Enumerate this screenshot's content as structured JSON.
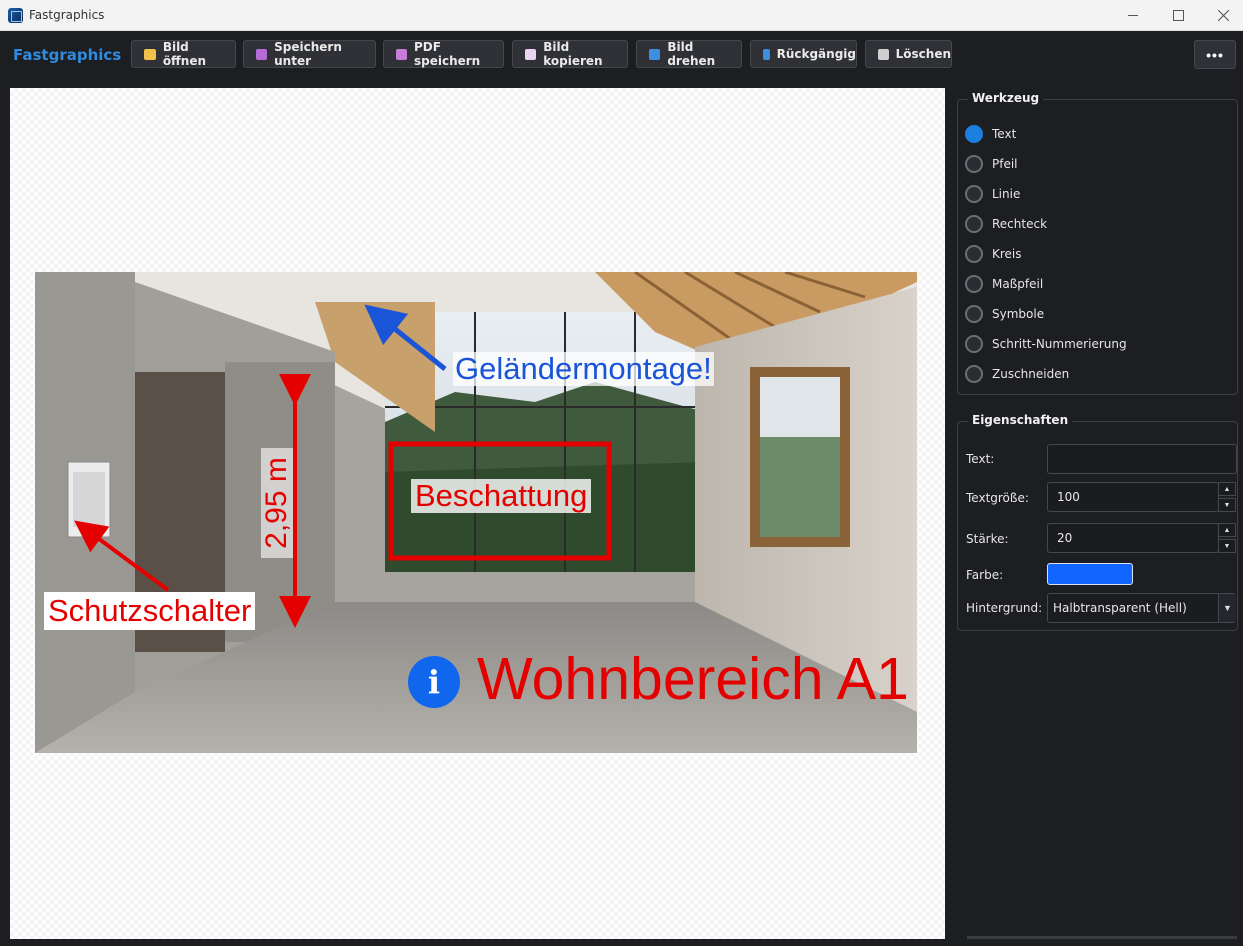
{
  "window": {
    "title": "Fastgraphics"
  },
  "toolbar": {
    "brand": "Fastgraphics",
    "buttons": [
      {
        "label": "Bild öffnen",
        "icon": "folder-icon"
      },
      {
        "label": "Speichern unter",
        "icon": "save-icon"
      },
      {
        "label": "PDF speichern",
        "icon": "print-icon"
      },
      {
        "label": "Bild kopieren",
        "icon": "copy-icon"
      },
      {
        "label": "Bild drehen",
        "icon": "rotate-icon"
      },
      {
        "label": "Rückgängig",
        "icon": "undo-icon"
      },
      {
        "label": "Löschen",
        "icon": "trash-icon"
      }
    ],
    "more_label": "•••"
  },
  "canvas": {
    "annotations": {
      "railing": "Geländermontage!",
      "shading": "Beschattung",
      "height": "2,95 m",
      "breaker": "Schutzschalter",
      "info_icon": "i",
      "area": "Wohnbereich A1"
    }
  },
  "tools": {
    "title": "Werkzeug",
    "items": [
      {
        "label": "Text",
        "checked": true
      },
      {
        "label": "Pfeil",
        "checked": false
      },
      {
        "label": "Linie",
        "checked": false
      },
      {
        "label": "Rechteck",
        "checked": false
      },
      {
        "label": "Kreis",
        "checked": false
      },
      {
        "label": "Maßpfeil",
        "checked": false
      },
      {
        "label": "Symbole",
        "checked": false
      },
      {
        "label": "Schritt-Nummerierung",
        "checked": false
      },
      {
        "label": "Zuschneiden",
        "checked": false
      }
    ]
  },
  "properties": {
    "title": "Eigenschaften",
    "text_label": "Text:",
    "text_value": "",
    "fontsize_label": "Textgröße:",
    "fontsize_value": "100",
    "stroke_label": "Stärke:",
    "stroke_value": "20",
    "color_label": "Farbe:",
    "color_value": "#1166ff",
    "background_label": "Hintergrund:",
    "background_value": "Halbtransparent (Hell)"
  },
  "colors": {
    "accent": "#2e8bdf",
    "annotation_red": "#e50000",
    "annotation_blue": "#1a55d8"
  }
}
